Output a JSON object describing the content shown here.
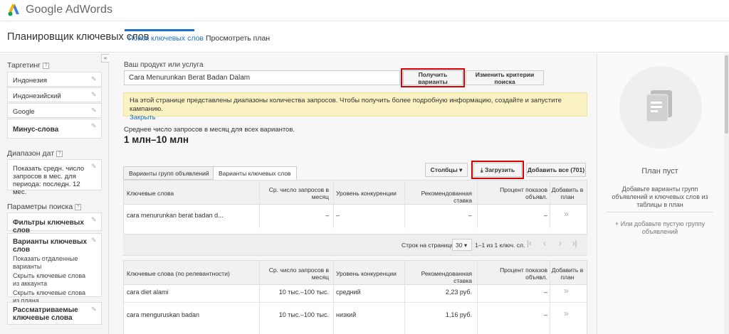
{
  "app": {
    "logo_text": "Google AdWords"
  },
  "header": {
    "page_title": "Планировщик ключевых слов",
    "tabs": [
      {
        "label": "Поиск ключевых слов",
        "active": true
      },
      {
        "label": "Просмотреть план",
        "active": false
      }
    ]
  },
  "sidebar": {
    "collapse_label": "«",
    "targeting_heading": "Таргетинг",
    "targeting_items": [
      "Индонезия",
      "Индонезийский",
      "Google",
      "Минус-слова"
    ],
    "date_heading": "Диапазон дат",
    "date_text": "Показать средн. число запросов в мес. для периода: последн. 12 мес.",
    "search_params_heading": "Параметры поиска",
    "keyword_filters": "Фильтры ключевых слов",
    "keyword_options": {
      "title": "Варианты ключевых слов",
      "lines": [
        "Показать отдаленные варианты",
        "Скрыть ключевые слова из аккаунта",
        "Скрыть ключевые слова из плана"
      ]
    },
    "considered_keywords": "Рассматриваемые ключевые слова"
  },
  "search": {
    "label": "Ваш продукт или услуга",
    "value": "Cara Menurunkan Berat Badan Dalam",
    "get_ideas_button": "Получить варианты",
    "modify_button": "Изменить критерии поиска"
  },
  "notice": {
    "text": "На этой странице представлены диапазоны количества запросов. Чтобы получить более подробную информацию, создайте и запустите кампанию.",
    "close_link": "Закрыть"
  },
  "stats": {
    "avg_label": "Среднее число запросов в месяц для всех вариантов.",
    "avg_value": "1 млн–10 млн"
  },
  "tabs2": {
    "ad_group_ideas": "Варианты групп объявлений",
    "keyword_ideas": "Варианты ключевых слов"
  },
  "toolbar": {
    "columns_button": "Столбцы",
    "download_button": "Загрузить",
    "add_all_button": "Добавить все (701)"
  },
  "table1": {
    "headers": [
      "Ключевые слова",
      "Ср. число запросов в месяц",
      "Уровень конкуренции",
      "Рекомендованная ставка",
      "Процент показов объявл.",
      "Добавить в план"
    ],
    "rows": [
      {
        "keyword": "cara menurunkan berat badan d...",
        "volume": "–",
        "competition": "–",
        "bid": "–",
        "impr": "–"
      }
    ]
  },
  "pager": {
    "rows_label": "Строк на странице:",
    "rows_value": "30",
    "range": "1–1 из 1 ключ. сл."
  },
  "table2": {
    "headers": [
      "Ключевые слова (по релевантности)",
      "Ср. число запросов в месяц",
      "Уровень конкуренции",
      "Рекомендованная ставка",
      "Процент показов объявл.",
      "Добавить в план"
    ],
    "rows": [
      {
        "keyword": "cara diet alami",
        "volume": "10 тыс.–100 тыс.",
        "competition": "средний",
        "bid": "2,23 руб.",
        "impr": "–"
      },
      {
        "keyword": "cara menguruskan badan",
        "volume": "10 тыс.–100 тыс.",
        "competition": "низкий",
        "bid": "1,16 руб.",
        "impr": "–"
      }
    ]
  },
  "plan": {
    "title": "План пуст",
    "description": "Добавьте варианты групп объявлений и ключевых слов из таблицы в план",
    "add_empty_group": "+ Или добавьте пустую группу объявлений"
  },
  "colors": {
    "accent": "#1a73c8",
    "highlight": "#d00000",
    "notice_bg": "#fbf2c4"
  }
}
